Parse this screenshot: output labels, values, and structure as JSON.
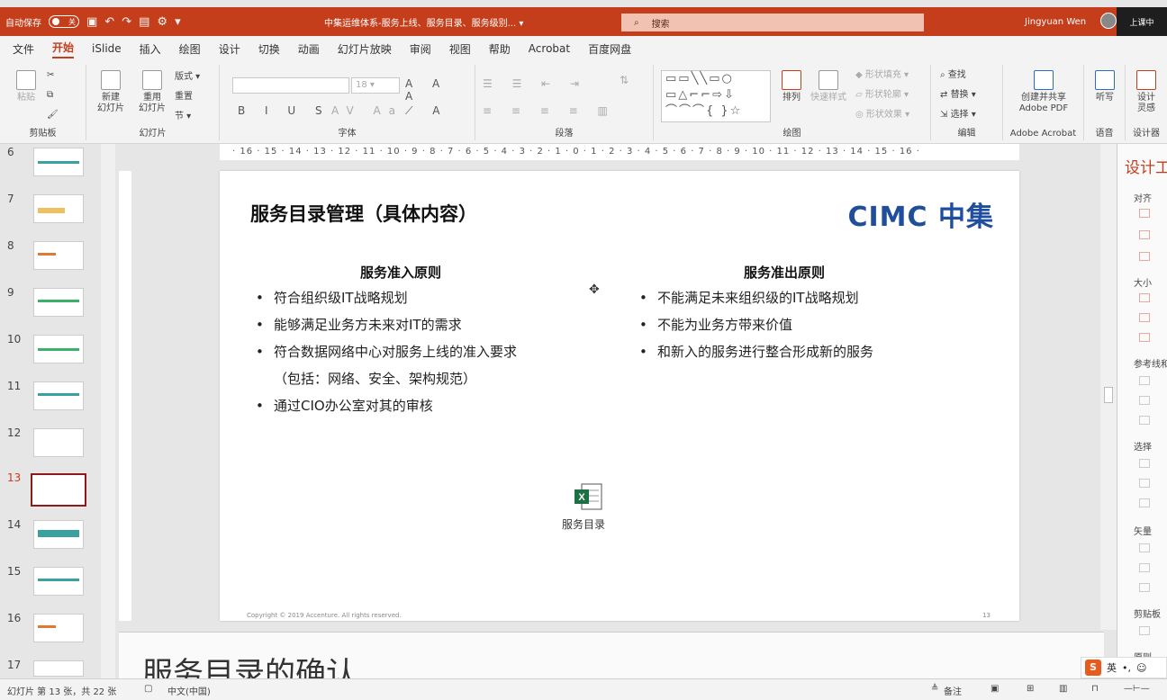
{
  "titlebar": {
    "autosave_label": "自动保存",
    "autosave_state": "关",
    "doc_title": "中集运维体系-服务上线、服务目录、服务级别... ▾",
    "search_placeholder": "搜索",
    "user_name": "Jingyuan Wen",
    "meeting_label": "上课中"
  },
  "menu": [
    "文件",
    "开始",
    "iSlide",
    "插入",
    "绘图",
    "设计",
    "切换",
    "动画",
    "幻灯片放映",
    "审阅",
    "视图",
    "帮助",
    "Acrobat",
    "百度网盘"
  ],
  "menu_active": "开始",
  "ribbon": {
    "groups": {
      "clipboard": "剪贴板",
      "slides": "幻灯片",
      "font": "字体",
      "paragraph": "段落",
      "drawing": "绘图",
      "editing": "编辑",
      "acrobat": "Adobe Acrobat",
      "voice": "语音",
      "design": "设计器"
    },
    "paste": "粘贴",
    "new_slide": "新建\n幻灯片",
    "reuse_slide": "重用\n幻灯片",
    "layout": "版式",
    "reset": "重置",
    "section": "节",
    "font_size": "18",
    "arrange": "排列",
    "quick_styles": "快速样式",
    "shape_fill": "形状填充",
    "shape_outline": "形状轮廓",
    "shape_effects": "形状效果",
    "find": "查找",
    "replace": "替换",
    "select": "选择",
    "create_pdf": "创建并共享\nAdobe PDF",
    "dictate": "听写",
    "designer": "设计\n灵感"
  },
  "thumbnails": [
    {
      "num": "6"
    },
    {
      "num": "7"
    },
    {
      "num": "8"
    },
    {
      "num": "9"
    },
    {
      "num": "10"
    },
    {
      "num": "11"
    },
    {
      "num": "12"
    },
    {
      "num": "13",
      "selected": true
    },
    {
      "num": "14"
    },
    {
      "num": "15"
    },
    {
      "num": "16"
    },
    {
      "num": "17"
    }
  ],
  "ruler_text": "· 16 · 15 · 14 · 13 · 12 · 11 · 10 · 9 · 8 · 7 · 6 · 5 · 4 · 3 · 2 · 1 · 0 · 1 · 2 · 3 · 4 · 5 · 6 · 7 · 8 · 9 · 10 · 11 · 12 · 13 · 14 · 15 · 16 ·",
  "slide": {
    "title": "服务目录管理（具体内容）",
    "logo": "CIMC 中集",
    "left_heading": "服务准入原则",
    "left_bullets": [
      "符合组织级IT战略规划",
      "能够满足业务方未来对IT的需求",
      "符合数据网络中心对服务上线的准入要求",
      "（包括：网络、安全、架构规范）",
      "通过CIO办公室对其的审核"
    ],
    "right_heading": "服务准出原则",
    "right_bullets": [
      "不能满足未来组织级的IT战略规划",
      "不能为业务方带来价值",
      "和新入的服务进行整合形成新的服务"
    ],
    "embedded_label": "服务目录",
    "copyright": "Copyright © 2019 Accenture. All rights reserved.",
    "page_number": "13"
  },
  "notes_text": "服务目录的确认",
  "right_pane": {
    "title": "设计工",
    "sections": [
      "对齐",
      "大小",
      "参考线和",
      "选择",
      "矢量",
      "剪贴板",
      "原则"
    ]
  },
  "status": {
    "slide_info": "幻灯片 第 13 张，共 22 张",
    "language": "中文(中国)",
    "notes": "备注"
  },
  "ime": {
    "lang": "英"
  }
}
